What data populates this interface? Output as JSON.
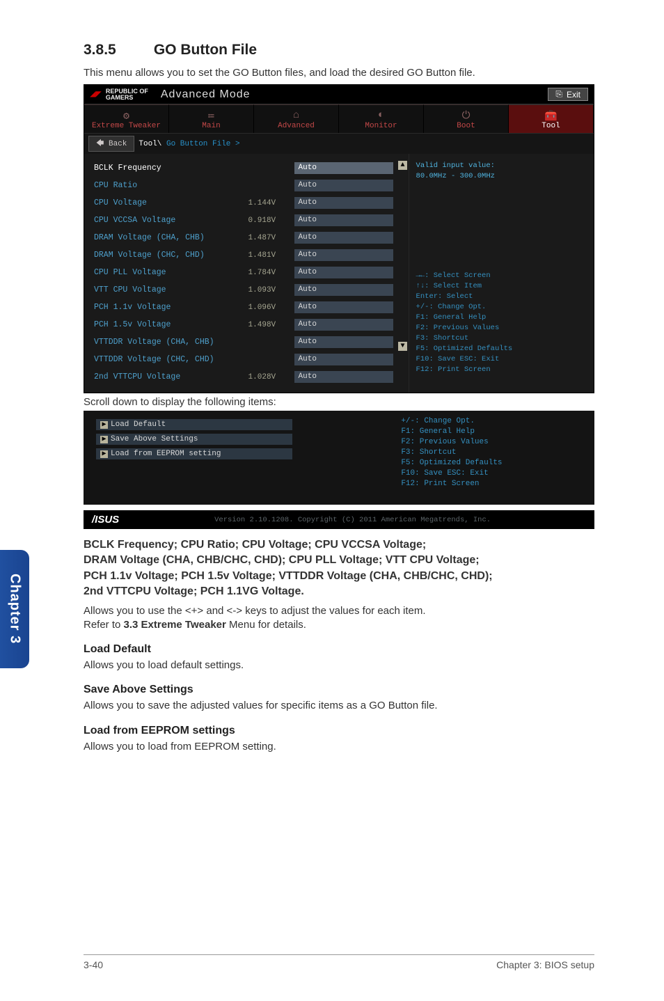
{
  "sidebarTab": "Chapter 3",
  "section": {
    "num": "3.8.5",
    "title": "GO Button File"
  },
  "intro": "This menu allows you to set the GO Button files, and load the desired GO Button file.",
  "bios": {
    "brandTop": "REPUBLIC OF",
    "brandBottom": "GAMERS",
    "mode": "Advanced Mode",
    "exit": "Exit",
    "tabs": [
      {
        "icon": "⚙",
        "label": "Extreme Tweaker"
      },
      {
        "icon": "≔",
        "label": "Main"
      },
      {
        "icon": "⌂",
        "label": "Advanced"
      },
      {
        "icon": "◐",
        "label": "Monitor"
      },
      {
        "icon": "⏻",
        "label": "Boot"
      },
      {
        "icon": "🧰",
        "label": "Tool"
      }
    ],
    "back": "Back",
    "crumbPre": "Tool\\ ",
    "crumbHl": "Go Button File >",
    "rows": [
      {
        "label": "BCLK Frequency",
        "read": "",
        "val": "Auto",
        "sel": true
      },
      {
        "label": "CPU Ratio",
        "read": "",
        "val": "Auto"
      },
      {
        "label": "CPU Voltage",
        "read": "1.144V",
        "val": "Auto"
      },
      {
        "label": "CPU VCCSA Voltage",
        "read": "0.918V",
        "val": "Auto"
      },
      {
        "label": "DRAM Voltage (CHA, CHB)",
        "read": "1.487V",
        "val": "Auto"
      },
      {
        "label": "DRAM Voltage (CHC, CHD)",
        "read": "1.481V",
        "val": "Auto"
      },
      {
        "label": "CPU PLL Voltage",
        "read": "1.784V",
        "val": "Auto"
      },
      {
        "label": "VTT CPU Voltage",
        "read": "1.093V",
        "val": "Auto"
      },
      {
        "label": "PCH 1.1v Voltage",
        "read": "1.096V",
        "val": "Auto"
      },
      {
        "label": "PCH 1.5v Voltage",
        "read": "1.498V",
        "val": "Auto"
      },
      {
        "label": "VTTDDR Voltage (CHA, CHB)",
        "read": "",
        "val": "Auto"
      },
      {
        "label": "VTTDDR Voltage (CHC, CHD)",
        "read": "",
        "val": "Auto"
      },
      {
        "label": "2nd VTTCPU Voltage",
        "read": "1.028V",
        "val": "Auto"
      }
    ],
    "helpTop": "Valid input value:\n80.0MHz - 300.0MHz",
    "hints": "→←: Select Screen\n↑↓: Select Item\nEnter: Select\n+/-: Change Opt.\nF1: General Help\nF2: Previous Values\nF3: Shortcut\nF5: Optimized Defaults\nF10: Save  ESC: Exit\nF12: Print Screen"
  },
  "scrollCaption": "Scroll down to display the following items:",
  "bios2": {
    "items": [
      "Load Default",
      "Save Above Settings",
      "Load from EEPROM setting"
    ],
    "hints": "+/-: Change Opt.\nF1: General Help\nF2: Previous Values\nF3: Shortcut\nF5: Optimized Defaults\nF10: Save  ESC: Exit\nF12: Print Screen",
    "footerBrand": "/ISUS",
    "version": "Version 2.10.1208. Copyright (C) 2011 American Megatrends, Inc."
  },
  "body": {
    "boldBlock": "BCLK Frequency; CPU Ratio; CPU Voltage; CPU VCCSA Voltage;\nDRAM Voltage (CHA, CHB/CHC, CHD); CPU PLL Voltage; VTT CPU Voltage;\nPCH 1.1v Voltage; PCH 1.5v Voltage; VTTDDR Voltage (CHA, CHB/CHC, CHD);\n2nd VTTCPU Voltage; PCH 1.1VG Voltage.",
    "para1a": "Allows you to use the <+> and <-> keys to adjust the values for each item.",
    "para1b": "Refer to 3.3 Extreme Tweaker Menu for details.",
    "h1": "Load Default",
    "p1": "Allows you to load default settings.",
    "h2": "Save Above Settings",
    "p2": "Allows you to save the adjusted values for specific items as a GO Button file.",
    "h3": "Load from EEPROM settings",
    "p3": "Allows you to load from EEPROM setting."
  },
  "footer": {
    "left": "3-40",
    "right": "Chapter 3: BIOS setup"
  }
}
